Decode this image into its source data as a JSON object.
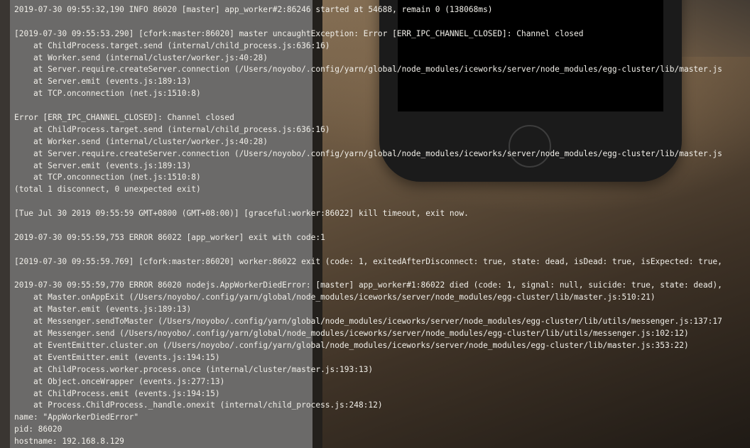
{
  "log_lines": [
    "2019-07-30 09:55:32,190 INFO 86020 [master] app_worker#2:86246 started at 54688, remain 0 (138068ms)",
    "",
    "[2019-07-30 09:55:53.290] [cfork:master:86020] master uncaughtException: Error [ERR_IPC_CHANNEL_CLOSED]: Channel closed",
    "    at ChildProcess.target.send (internal/child_process.js:636:16)",
    "    at Worker.send (internal/cluster/worker.js:40:28)",
    "    at Server.require.createServer.connection (/Users/noyobo/.config/yarn/global/node_modules/iceworks/server/node_modules/egg-cluster/lib/master.js",
    "    at Server.emit (events.js:189:13)",
    "    at TCP.onconnection (net.js:1510:8)",
    "",
    "Error [ERR_IPC_CHANNEL_CLOSED]: Channel closed",
    "    at ChildProcess.target.send (internal/child_process.js:636:16)",
    "    at Worker.send (internal/cluster/worker.js:40:28)",
    "    at Server.require.createServer.connection (/Users/noyobo/.config/yarn/global/node_modules/iceworks/server/node_modules/egg-cluster/lib/master.js",
    "    at Server.emit (events.js:189:13)",
    "    at TCP.onconnection (net.js:1510:8)",
    "(total 1 disconnect, 0 unexpected exit)",
    "",
    "[Tue Jul 30 2019 09:55:59 GMT+0800 (GMT+08:00)] [graceful:worker:86022] kill timeout, exit now.",
    "",
    "2019-07-30 09:55:59,753 ERROR 86022 [app_worker] exit with code:1",
    "",
    "[2019-07-30 09:55:59.769] [cfork:master:86020] worker:86022 exit (code: 1, exitedAfterDisconnect: true, state: dead, isDead: true, isExpected: true,",
    "",
    "2019-07-30 09:55:59,770 ERROR 86020 nodejs.AppWorkerDiedError: [master] app_worker#1:86022 died (code: 1, signal: null, suicide: true, state: dead),",
    "    at Master.onAppExit (/Users/noyobo/.config/yarn/global/node_modules/iceworks/server/node_modules/egg-cluster/lib/master.js:510:21)",
    "    at Master.emit (events.js:189:13)",
    "    at Messenger.sendToMaster (/Users/noyobo/.config/yarn/global/node_modules/iceworks/server/node_modules/egg-cluster/lib/utils/messenger.js:137:17",
    "    at Messenger.send (/Users/noyobo/.config/yarn/global/node_modules/iceworks/server/node_modules/egg-cluster/lib/utils/messenger.js:102:12)",
    "    at EventEmitter.cluster.on (/Users/noyobo/.config/yarn/global/node_modules/iceworks/server/node_modules/egg-cluster/lib/master.js:353:22)",
    "    at EventEmitter.emit (events.js:194:15)",
    "    at ChildProcess.worker.process.once (internal/cluster/master.js:193:13)",
    "    at Object.onceWrapper (events.js:277:13)",
    "    at ChildProcess.emit (events.js:194:15)",
    "    at Process.ChildProcess._handle.onexit (internal/child_process.js:248:12)",
    "name: \"AppWorkerDiedError\"",
    "pid: 86020",
    "hostname: 192.168.8.129"
  ]
}
